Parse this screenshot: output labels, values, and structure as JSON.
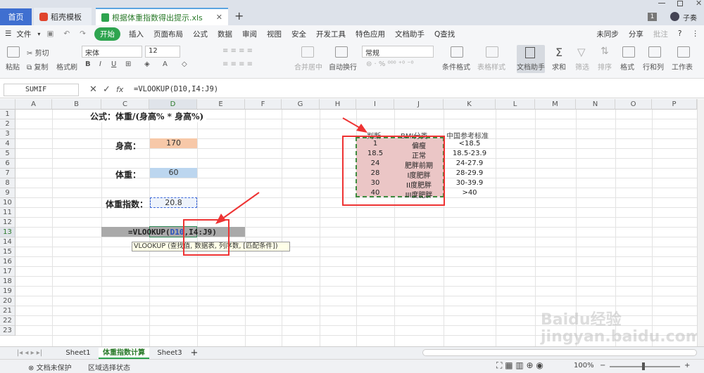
{
  "titlebar": {
    "tabs": [
      {
        "label": "首页"
      },
      {
        "label": "稻壳模板"
      },
      {
        "label": "根据体重指数得出提示.xls"
      }
    ],
    "new_tab": "+",
    "page_badge": "1",
    "user": "子奏"
  },
  "menu": {
    "file": "文件",
    "items": [
      "开始",
      "插入",
      "页面布局",
      "公式",
      "数据",
      "审阅",
      "视图",
      "安全",
      "开发工具",
      "特色应用",
      "文档助手",
      "Q查找"
    ],
    "right": [
      "未同步",
      "分享",
      "批注"
    ],
    "help": "?"
  },
  "toolbar": {
    "paste": "粘贴",
    "cut": "剪切",
    "copy": "复制",
    "format_painter": "格式刷",
    "font": "宋体",
    "font_size": "12",
    "merge": "合并居中",
    "wrap": "自动换行",
    "number_format": "常规",
    "cond_format": "条件格式",
    "table_style": "表格样式",
    "doc_helper": "文档助手",
    "sum": "求和",
    "filter": "筛选",
    "sort": "排序",
    "format": "格式",
    "rowcol": "行和列",
    "sheet": "工作表"
  },
  "formula_bar": {
    "name_box": "SUMIF",
    "fx": "fx",
    "formula": "=VLOOKUP(D10,I4:J9)"
  },
  "columns": [
    "A",
    "B",
    "C",
    "D",
    "E",
    "F",
    "G",
    "H",
    "I",
    "J",
    "K",
    "L",
    "M",
    "N",
    "O",
    "P"
  ],
  "rows": [
    "1",
    "2",
    "3",
    "4",
    "5",
    "6",
    "7",
    "8",
    "9",
    "10",
    "11",
    "12",
    "13",
    "14",
    "15",
    "16",
    "17",
    "18",
    "19",
    "20",
    "21",
    "22",
    "23"
  ],
  "cells": {
    "formula_title": "公式：体重/(身高% * 身高%)",
    "height_label": "身高：",
    "height_value": "170",
    "weight_label": "体重：",
    "weight_value": "60",
    "bmi_label": "体重指数：",
    "bmi_value": "20.8",
    "editing_formula_prefix": "=VLOOKUP(",
    "editing_formula_ref1": "D10",
    "editing_formula_sep": ",",
    "editing_formula_ref2": "I4:J9",
    "editing_formula_suffix": ")",
    "tooltip": "VLOOKUP (查找值, 数据表, 列序数, [匹配条件])"
  },
  "bmi_table": {
    "headers": [
      "判断",
      "BMI分类",
      "中国参考标准"
    ],
    "rows": [
      [
        "1",
        "偏瘦",
        "<18.5"
      ],
      [
        "18.5",
        "正常",
        "18.5-23.9"
      ],
      [
        "24",
        "肥胖前期",
        "24-27.9"
      ],
      [
        "28",
        "I度肥胖",
        "28-29.9"
      ],
      [
        "30",
        "II度肥胖",
        "30-39.9"
      ],
      [
        "40",
        "III度肥胖",
        ">40"
      ]
    ]
  },
  "sheets": [
    "Sheet1",
    "体重指数计算",
    "Sheet3"
  ],
  "add_sheet": "+",
  "status": {
    "protect": "文档未保护",
    "selection": "区域选择状态",
    "zoom": "100%"
  },
  "colors": {
    "accent": "#2ea44f",
    "height_fill": "#f7c8a8",
    "weight_fill": "#bcd6ef",
    "table_fill": "#ebc6c6",
    "highlight_red": "#e33333"
  },
  "watermark": "Baidu经验 jingyan.baidu.com"
}
